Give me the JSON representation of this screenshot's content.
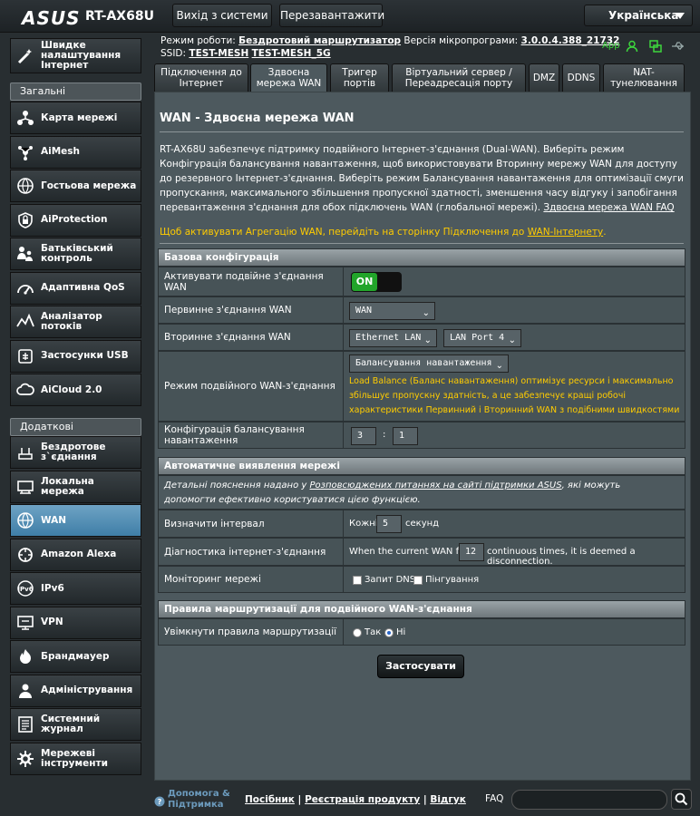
{
  "header": {
    "logo": "ASUS",
    "model": "RT-AX68U",
    "logout_label": "Вихід з системи",
    "reboot_label": "Перезавантажити",
    "language": "Українська"
  },
  "status": {
    "mode_label": "Режим роботи:",
    "mode_value": "Бездротовий маршрутизатор",
    "fw_label": "Версія мікропрограми:",
    "fw_value": "3.0.0.4.388_21732",
    "ssid_label": "SSID:",
    "ssid1": "TEST-MESH",
    "ssid2": "TEST-MESH_5G",
    "app_label": "App"
  },
  "sidebar": {
    "quick_setup": "Швидке налаштування Інтернет",
    "general_header": "Загальні налаштування",
    "general": [
      "Карта мережі",
      "AiMesh",
      "Гостьова мережа",
      "AiProtection",
      "Батьківський контроль",
      "Адаптивна QoS",
      "Аналізатор потоків",
      "Застосунки USB",
      "AiCloud 2.0"
    ],
    "advanced_header": "Додаткові налаштування",
    "advanced": [
      "Бездротове з`єднання",
      "Локальна мережа",
      "WAN",
      "Amazon Alexa",
      "IPv6",
      "VPN",
      "Брандмауер",
      "Адміністрування",
      "Системний журнал",
      "Мережеві інструменти"
    ]
  },
  "tabs": [
    "Підключення до Інтернет",
    "Здвоєна мережа WAN",
    "Тригер портів",
    "Віртуальний сервер / Переадресація порту",
    "DMZ",
    "DDNS",
    "NAT-тунелювання"
  ],
  "page": {
    "title": "WAN - Здвоєна мережа WAN",
    "desc": "RT-AX68U забезпечує підтримку подвійного Інтернет-з'єднання (Dual-WAN). Виберіть режим Конфігурація балансування навантаження, щоб використовувати Вторинну мережу WAN для доступу до резервного Інтернет-з'єднання. Виберіть режим Балансування навантаження для оптимізації смуги пропускання, максимального збільшення пропускної здатності, зменшення часу відгуку і запобігання перевантаження з'єднання для обох підключень WAN (глобальної мережі).",
    "faq_link": "Здвоєна мережа WAN FAQ",
    "agg_text": "Щоб активувати Агрегацію WAN, перейдіть на сторінку Підключення до",
    "agg_link": "WAN-Інтернету",
    "agg_end": "."
  },
  "basic": {
    "header": "Базова конфігурація",
    "enable_label": "Активувати подвійне з'єднання WAN",
    "toggle_on": "ON",
    "primary_label": "Первинне з'єднання WAN",
    "primary_value": "WAN",
    "secondary_label": "Вторинне з'єднання WAN",
    "secondary_value": "Ethernet LAN",
    "secondary_port": "LAN Port 4",
    "mode_label": "Режим подвійного WAN-з'єднання",
    "mode_value": "Балансування навантаження",
    "mode_note": "Load Balance (Баланс навантаження) оптимізує ресурси і максимально збільшує пропускну здатність, а це забезпечує кращі робочі характеристики Первинний і Вторинний WAN з подібними швидкостями мереж.",
    "lb_label": "Конфігурація балансування навантаження",
    "lb_value1": "3",
    "lb_sep": ":",
    "lb_value2": "1"
  },
  "detect": {
    "header": "Автоматичне виявлення мережі",
    "note_pre": "Детальні пояснення надано у",
    "note_link": "Розповсюджених питаннях на сайті підтримки ASUS",
    "note_post": ", які можуть допомогти ефективно користуватися цією функцією.",
    "interval_label": "Визначити інтервал",
    "interval_pre": "Кожні",
    "interval_value": "5",
    "interval_post": "секунд",
    "diag_label": "Діагностика інтернет-з'єднання",
    "diag_pre": "When the current WAN fails",
    "diag_value": "12",
    "diag_post": "continuous times, it is deemed a disconnection.",
    "monitor_label": "Моніторинг мережі",
    "dns_label": "Запит DNS",
    "ping_label": "Пінгування"
  },
  "routing": {
    "header": "Правила маршрутизації для подвійного WAN-з'єднання",
    "enable_label": "Увімкнути правила маршрутизації",
    "yes": "Так",
    "no": "Ні"
  },
  "apply_label": "Застосувати",
  "footer": {
    "help": "Допомога & Підтримка",
    "manual": "Посібник",
    "register": "Реєстрація продукту",
    "feedback": "Відгук",
    "faq": "FAQ"
  },
  "colors": {
    "accent": "#3f7ea7",
    "yellow": "#ffcc00",
    "toggle_green": "#22a52a"
  }
}
